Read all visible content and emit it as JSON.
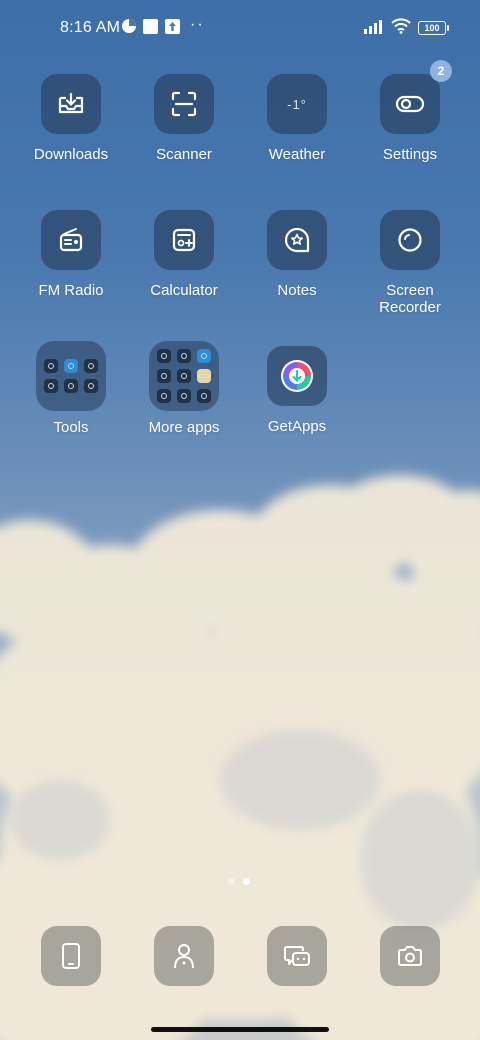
{
  "status_bar": {
    "time": "8:16 AM",
    "dots": "··",
    "battery": "100"
  },
  "apps": [
    {
      "label": "Downloads",
      "icon": "download-box-icon"
    },
    {
      "label": "Scanner",
      "icon": "scan-frame-icon"
    },
    {
      "label": "Weather",
      "icon": "weather-temp-icon",
      "temp": "-1°"
    },
    {
      "label": "Settings",
      "icon": "toggle-settings-icon",
      "badge": "2"
    },
    {
      "label": "FM Radio",
      "icon": "radio-icon"
    },
    {
      "label": "Calculator",
      "icon": "calculator-icon"
    },
    {
      "label": "Notes",
      "icon": "notes-bubble-icon"
    },
    {
      "label": "Screen\nRecorder",
      "icon": "screen-recorder-icon"
    },
    {
      "label": "Tools",
      "icon": "folder-icon"
    },
    {
      "label": "More apps",
      "icon": "folder-icon"
    },
    {
      "label": "GetApps",
      "icon": "getapps-icon"
    }
  ],
  "dock": [
    {
      "icon": "phone-icon"
    },
    {
      "icon": "contacts-icon"
    },
    {
      "icon": "messages-icon"
    },
    {
      "icon": "camera-icon"
    }
  ],
  "pages": {
    "count": 2,
    "active": 2
  }
}
